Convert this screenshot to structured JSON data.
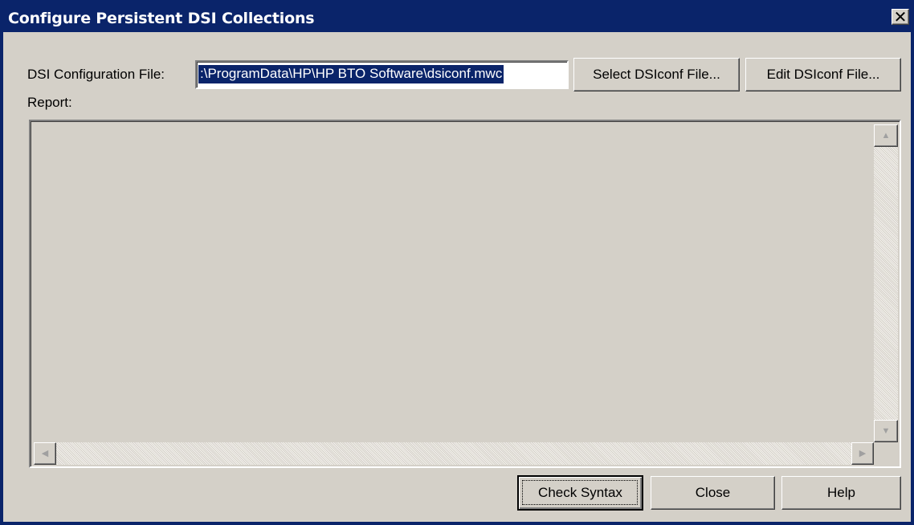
{
  "window": {
    "title": "Configure Persistent DSI Collections",
    "close_glyph": "✕"
  },
  "config_file": {
    "label": "DSI Configuration File:",
    "value": ":\\ProgramData\\HP\\HP BTO Software\\dsiconf.mwc"
  },
  "buttons": {
    "select": "Select DSIconf File...",
    "edit": "Edit DSIconf File...",
    "check_syntax": "Check Syntax",
    "close": "Close",
    "help": "Help"
  },
  "report": {
    "label": "Report:",
    "content": ""
  },
  "scroll_glyphs": {
    "up": "▲",
    "down": "▼",
    "left": "◀",
    "right": "▶"
  },
  "colors": {
    "titlebar": "#0a246a",
    "dialog_face": "#d4d0c8",
    "selection": "#0a246a"
  }
}
